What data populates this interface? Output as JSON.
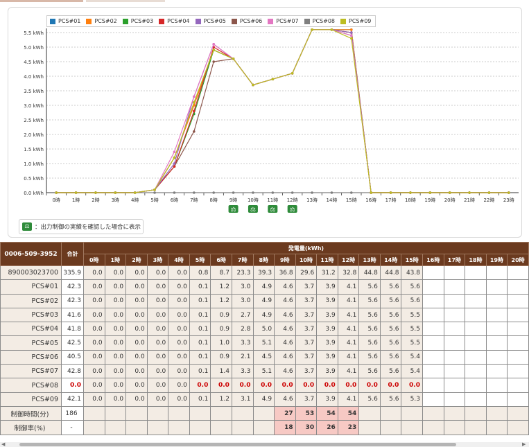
{
  "legend": [
    {
      "name": "PCS#01",
      "color": "#1f77b4"
    },
    {
      "name": "PCS#02",
      "color": "#ff7f0e"
    },
    {
      "name": "PCS#03",
      "color": "#2ca02c"
    },
    {
      "name": "PCS#04",
      "color": "#d62728"
    },
    {
      "name": "PCS#05",
      "color": "#9467bd"
    },
    {
      "name": "PCS#06",
      "color": "#8c564b"
    },
    {
      "name": "PCS#07",
      "color": "#e377c2"
    },
    {
      "name": "PCS#08",
      "color": "#7f7f7f"
    },
    {
      "name": "PCS#09",
      "color": "#bcbd22"
    }
  ],
  "chart_data": {
    "type": "line",
    "title": "",
    "xlabel": "",
    "ylabel": "",
    "x": [
      "0時",
      "1時",
      "2時",
      "3時",
      "4時",
      "5時",
      "6時",
      "7時",
      "8時",
      "9時",
      "10時",
      "11時",
      "12時",
      "13時",
      "14時",
      "15時",
      "16時",
      "17時",
      "18時",
      "19時",
      "20時",
      "21時",
      "22時",
      "23時"
    ],
    "yticks": [
      "0.0 kWh",
      "0.5 kWh",
      "1.0 kWh",
      "1.5 kWh",
      "2.0 kWh",
      "2.5 kWh",
      "3.0 kWh",
      "3.5 kWh",
      "4.0 kWh",
      "4.5 kWh",
      "5.0 kWh",
      "5.5 kWh"
    ],
    "ylim": [
      0,
      5.6
    ],
    "grid": true,
    "legend_position": "top",
    "control_markers_at": [
      "9時",
      "10時",
      "11時",
      "12時"
    ],
    "series": [
      {
        "name": "PCS#01",
        "values": [
          0,
          0,
          0,
          0,
          0,
          0.1,
          1.2,
          3.0,
          4.9,
          4.6,
          3.7,
          3.9,
          4.1,
          5.6,
          5.6,
          5.6,
          0,
          0,
          0,
          0,
          0,
          0,
          0,
          0
        ]
      },
      {
        "name": "PCS#02",
        "values": [
          0,
          0,
          0,
          0,
          0,
          0.1,
          1.2,
          3.0,
          4.9,
          4.6,
          3.7,
          3.9,
          4.1,
          5.6,
          5.6,
          5.6,
          0,
          0,
          0,
          0,
          0,
          0,
          0,
          0
        ]
      },
      {
        "name": "PCS#03",
        "values": [
          0,
          0,
          0,
          0,
          0,
          0.1,
          0.9,
          2.7,
          4.9,
          4.6,
          3.7,
          3.9,
          4.1,
          5.6,
          5.6,
          5.5,
          0,
          0,
          0,
          0,
          0,
          0,
          0,
          0
        ]
      },
      {
        "name": "PCS#04",
        "values": [
          0,
          0,
          0,
          0,
          0,
          0.1,
          0.9,
          2.8,
          5.0,
          4.6,
          3.7,
          3.9,
          4.1,
          5.6,
          5.6,
          5.5,
          0,
          0,
          0,
          0,
          0,
          0,
          0,
          0
        ]
      },
      {
        "name": "PCS#05",
        "values": [
          0,
          0,
          0,
          0,
          0,
          0.1,
          1.0,
          3.3,
          5.1,
          4.6,
          3.7,
          3.9,
          4.1,
          5.6,
          5.6,
          5.5,
          0,
          0,
          0,
          0,
          0,
          0,
          0,
          0
        ]
      },
      {
        "name": "PCS#06",
        "values": [
          0,
          0,
          0,
          0,
          0,
          0.1,
          0.9,
          2.1,
          4.5,
          4.6,
          3.7,
          3.9,
          4.1,
          5.6,
          5.6,
          5.4,
          0,
          0,
          0,
          0,
          0,
          0,
          0,
          0
        ]
      },
      {
        "name": "PCS#07",
        "values": [
          0,
          0,
          0,
          0,
          0,
          0.1,
          1.4,
          3.3,
          5.1,
          4.6,
          3.7,
          3.9,
          4.1,
          5.6,
          5.6,
          5.4,
          0,
          0,
          0,
          0,
          0,
          0,
          0,
          0
        ]
      },
      {
        "name": "PCS#08",
        "values": [
          0,
          0,
          0,
          0,
          0,
          0,
          0,
          0,
          0,
          0,
          0,
          0,
          0,
          0,
          0,
          0,
          0,
          0,
          0,
          0,
          0,
          0,
          0,
          0
        ]
      },
      {
        "name": "PCS#09",
        "values": [
          0,
          0,
          0,
          0,
          0,
          0.1,
          1.2,
          3.1,
          4.9,
          4.6,
          3.7,
          3.9,
          4.1,
          5.6,
          5.6,
          5.3,
          0,
          0,
          0,
          0,
          0,
          0,
          0,
          0
        ]
      }
    ]
  },
  "note": {
    "icon": "balance-scale-icon",
    "icon_text": "⚖",
    "text": "：出力制御の実績を確認した場合に表示"
  },
  "table": {
    "site_id": "0006-509-3952",
    "total_header": "合計",
    "group_header": "発電量(kWh)",
    "hours": [
      "0時",
      "1時",
      "2時",
      "3時",
      "4時",
      "5時",
      "6時",
      "7時",
      "8時",
      "9時",
      "10時",
      "11時",
      "12時",
      "13時",
      "14時",
      "15時",
      "16時",
      "17時",
      "18時",
      "19時",
      "20時"
    ],
    "rows": [
      {
        "label": "890003023700",
        "total": "335.9",
        "values": [
          "0.0",
          "0.0",
          "0.0",
          "0.0",
          "0.0",
          "0.8",
          "8.7",
          "23.3",
          "39.3",
          "36.8",
          "29.6",
          "31.2",
          "32.8",
          "44.8",
          "44.8",
          "43.8"
        ]
      },
      {
        "label": "PCS#01",
        "total": "42.3",
        "values": [
          "0.0",
          "0.0",
          "0.0",
          "0.0",
          "0.0",
          "0.1",
          "1.2",
          "3.0",
          "4.9",
          "4.6",
          "3.7",
          "3.9",
          "4.1",
          "5.6",
          "5.6",
          "5.6"
        ]
      },
      {
        "label": "PCS#02",
        "total": "42.3",
        "values": [
          "0.0",
          "0.0",
          "0.0",
          "0.0",
          "0.0",
          "0.1",
          "1.2",
          "3.0",
          "4.9",
          "4.6",
          "3.7",
          "3.9",
          "4.1",
          "5.6",
          "5.6",
          "5.6"
        ]
      },
      {
        "label": "PCS#03",
        "total": "41.6",
        "values": [
          "0.0",
          "0.0",
          "0.0",
          "0.0",
          "0.0",
          "0.1",
          "0.9",
          "2.7",
          "4.9",
          "4.6",
          "3.7",
          "3.9",
          "4.1",
          "5.6",
          "5.6",
          "5.5"
        ]
      },
      {
        "label": "PCS#04",
        "total": "41.8",
        "values": [
          "0.0",
          "0.0",
          "0.0",
          "0.0",
          "0.0",
          "0.1",
          "0.9",
          "2.8",
          "5.0",
          "4.6",
          "3.7",
          "3.9",
          "4.1",
          "5.6",
          "5.6",
          "5.5"
        ]
      },
      {
        "label": "PCS#05",
        "total": "42.5",
        "values": [
          "0.0",
          "0.0",
          "0.0",
          "0.0",
          "0.0",
          "0.1",
          "1.0",
          "3.3",
          "5.1",
          "4.6",
          "3.7",
          "3.9",
          "4.1",
          "5.6",
          "5.6",
          "5.5"
        ]
      },
      {
        "label": "PCS#06",
        "total": "40.5",
        "values": [
          "0.0",
          "0.0",
          "0.0",
          "0.0",
          "0.0",
          "0.1",
          "0.9",
          "2.1",
          "4.5",
          "4.6",
          "3.7",
          "3.9",
          "4.1",
          "5.6",
          "5.6",
          "5.4"
        ]
      },
      {
        "label": "PCS#07",
        "total": "42.8",
        "values": [
          "0.0",
          "0.0",
          "0.0",
          "0.0",
          "0.0",
          "0.1",
          "1.4",
          "3.3",
          "5.1",
          "4.6",
          "3.7",
          "3.9",
          "4.1",
          "5.6",
          "5.6",
          "5.4"
        ]
      },
      {
        "label": "PCS#08",
        "total": "0.0",
        "alert": true,
        "values": [
          "0.0",
          "0.0",
          "0.0",
          "0.0",
          "0.0",
          "0.0",
          "0.0",
          "0.0",
          "0.0",
          "0.0",
          "0.0",
          "0.0",
          "0.0",
          "0.0",
          "0.0",
          "0.0"
        ]
      },
      {
        "label": "PCS#09",
        "total": "42.1",
        "values": [
          "0.0",
          "0.0",
          "0.0",
          "0.0",
          "0.0",
          "0.1",
          "1.2",
          "3.1",
          "4.9",
          "4.6",
          "3.7",
          "3.9",
          "4.1",
          "5.6",
          "5.6",
          "5.3"
        ]
      }
    ],
    "control_rows": [
      {
        "label": "制御時間(分)",
        "total": "186",
        "values": {
          "9": "27",
          "10": "53",
          "11": "54",
          "12": "54"
        }
      },
      {
        "label": "制御率(%)",
        "total": "-",
        "values": {
          "9": "18",
          "10": "30",
          "11": "26",
          "12": "23"
        }
      }
    ],
    "alert_color": "#cc0000",
    "control_highlight_color": "#f7c9c4"
  }
}
